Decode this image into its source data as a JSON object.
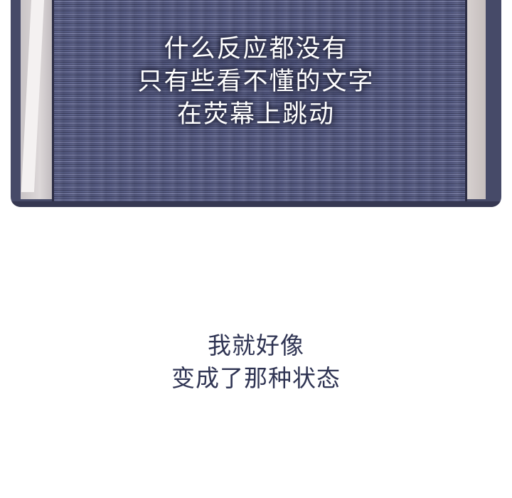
{
  "panel": {
    "caption_lines": [
      "什么反应都没有",
      "只有些看不懂的文字",
      "在荧幕上跳动"
    ]
  },
  "narration": {
    "lines": [
      "我就好像",
      "变成了那种状态"
    ]
  },
  "colors": {
    "screen": "#4c5075",
    "panel_border": "#363852",
    "narration_text": "#2f3453",
    "background": "#ffffff"
  }
}
